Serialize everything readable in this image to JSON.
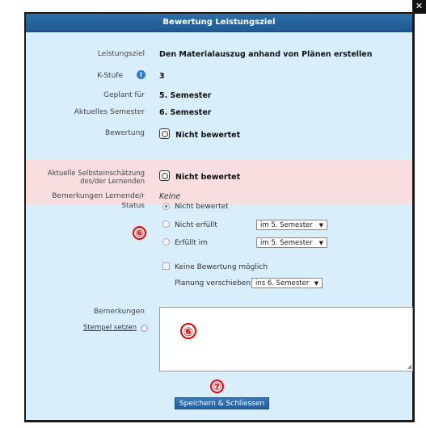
{
  "dialog": {
    "title": "Bewertung Leistungsziel",
    "close_icon": "close-icon"
  },
  "fields": {
    "leistungsziel_label": "Leistungsziel",
    "leistungsziel_value": "Den Materialauszug anhand von Plänen erstellen",
    "kstufe_label": "K-Stufe",
    "kstufe_value": "3",
    "geplant_label": "Geplant für",
    "geplant_value": "5. Semester",
    "aktuell_label": "Aktuelles Semester",
    "aktuell_value": "6. Semester",
    "bewertung_label": "Bewertung",
    "bewertung_value": "Nicht bewertet"
  },
  "selbst": {
    "label_line1": "Aktuelle Selbsteinschätzung",
    "label_line2": "des/der Lernenden",
    "value": "Nicht bewertet",
    "bemerkungen_label": "Bemerkungen Lernende/r",
    "bemerkungen_value": "Keine"
  },
  "status": {
    "label": "Status",
    "options": [
      {
        "label": "Nicht bewertet",
        "checked": true
      },
      {
        "label": "Nicht erfüllt",
        "checked": false,
        "select": "im 5. Semester"
      },
      {
        "label": "Erfüllt im",
        "checked": false,
        "select": "im 5. Semester"
      }
    ],
    "keine_bewertung": "Keine Bewertung möglich",
    "planung_label": "Planung verschieben",
    "planung_select": "ins 6. Semester"
  },
  "bemerkungen": {
    "label": "Bemerkungen",
    "stempel_link": "Stempel setzen"
  },
  "badges": {
    "six": "⑥",
    "seven": "⑦"
  },
  "actions": {
    "save_label": "Speichern & Schliessen"
  },
  "colors": {
    "titlebar": "#1f5a94",
    "background": "#d9eefb",
    "highlight": "#f8dede",
    "badge": "#e00000"
  }
}
